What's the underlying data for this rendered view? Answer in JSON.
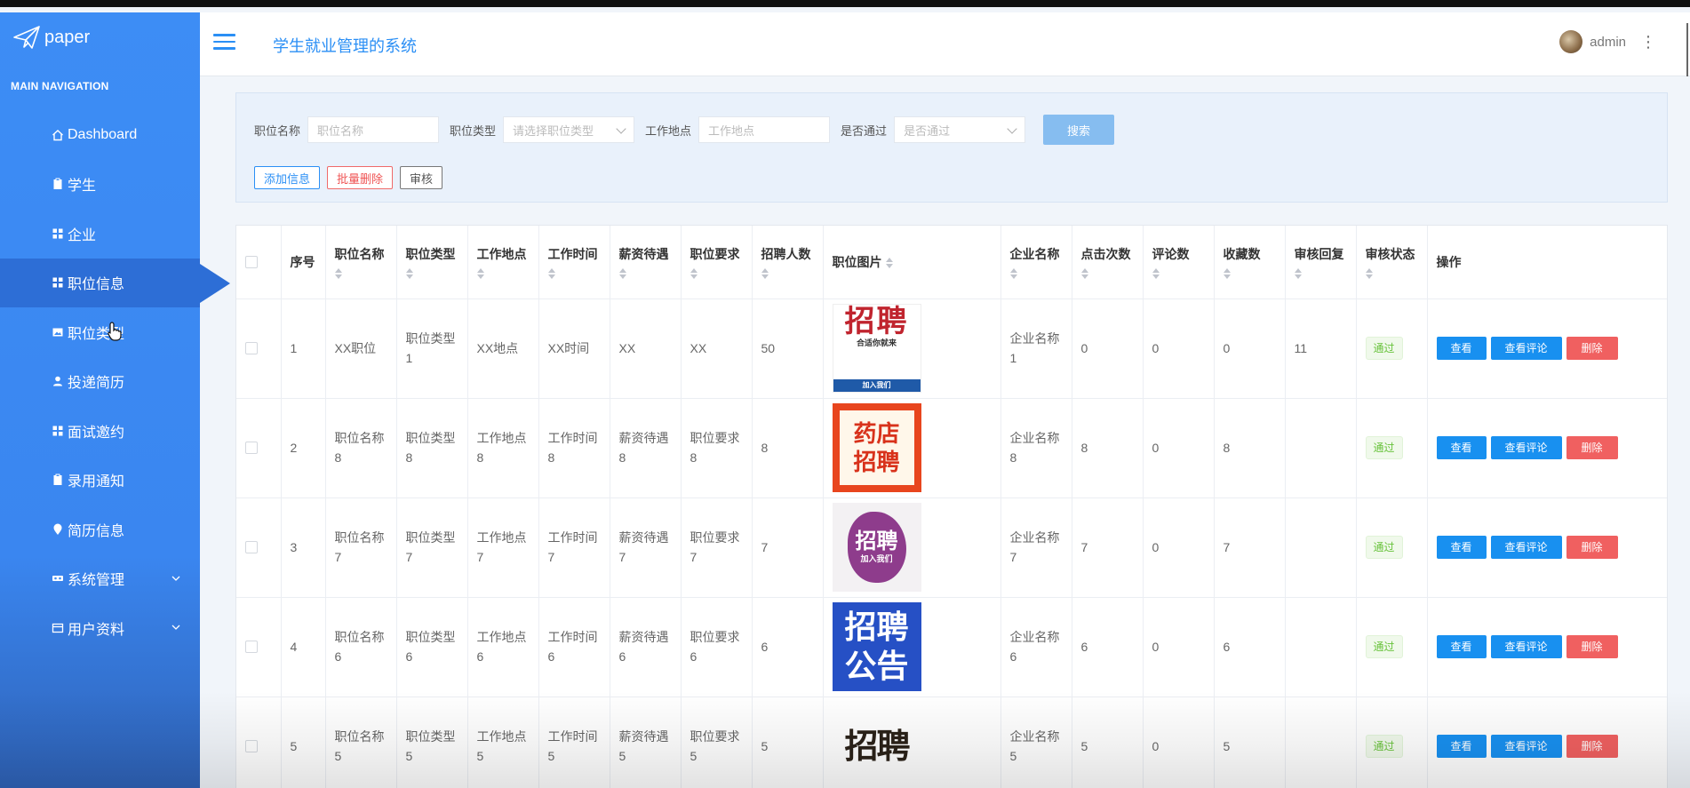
{
  "app": {
    "logo_text": "paper",
    "title": "学生就业管理的系统",
    "user_name": "admin"
  },
  "sidebar": {
    "heading": "MAIN NAVIGATION",
    "items": [
      {
        "label": "Dashboard",
        "icon": "home-icon"
      },
      {
        "label": "学生",
        "icon": "clipboard-icon"
      },
      {
        "label": "企业",
        "icon": "grid-icon"
      },
      {
        "label": "职位信息",
        "icon": "grid-icon",
        "active": true
      },
      {
        "label": "职位类型",
        "icon": "image-icon"
      },
      {
        "label": "投递简历",
        "icon": "user-icon"
      },
      {
        "label": "面试邀约",
        "icon": "grid-icon"
      },
      {
        "label": "录用通知",
        "icon": "clipboard-icon"
      },
      {
        "label": "简历信息",
        "icon": "pin-icon"
      },
      {
        "label": "系统管理",
        "icon": "cog-icon",
        "expandable": true
      },
      {
        "label": "用户资料",
        "icon": "card-icon",
        "expandable": true
      }
    ]
  },
  "filter": {
    "job_name_label": "职位名称",
    "job_name_placeholder": "职位名称",
    "job_type_label": "职位类型",
    "job_type_placeholder": "请选择职位类型",
    "location_label": "工作地点",
    "location_placeholder": "工作地点",
    "approved_label": "是否通过",
    "approved_placeholder": "是否通过",
    "search_label": "搜索",
    "add_label": "添加信息",
    "batch_delete_label": "批量删除",
    "review_label": "审核"
  },
  "table": {
    "headers": {
      "seq": "序号",
      "job_name": "职位名称",
      "job_type": "职位类型",
      "location": "工作地点",
      "work_time": "工作时间",
      "salary": "薪资待遇",
      "requirement": "职位要求",
      "headcount": "招聘人数",
      "picture": "职位图片",
      "company": "企业名称",
      "clicks": "点击次数",
      "comments": "评论数",
      "favorites": "收藏数",
      "review_reply": "审核回复",
      "review_status": "审核状态",
      "actions": "操作"
    },
    "rows": [
      {
        "seq": "1",
        "job_name": "XX职位",
        "job_type": "职位类型1",
        "location": "XX地点",
        "work_time": "XX时间",
        "salary": "XX",
        "requirement": "XX",
        "headcount": "50",
        "pic_text": "招聘",
        "pic_sub": "合适你就来",
        "pic_bar": "加入我们",
        "company": "企业名称1",
        "clicks": "0",
        "comments": "0",
        "favorites": "0",
        "review_reply": "11",
        "status": "通过"
      },
      {
        "seq": "2",
        "job_name": "职位名称8",
        "job_type": "职位类型8",
        "location": "工作地点8",
        "work_time": "工作时间8",
        "salary": "薪资待遇8",
        "requirement": "职位要求8",
        "headcount": "8",
        "pic_text_1": "药店",
        "pic_text_2": "招聘",
        "company": "企业名称8",
        "clicks": "8",
        "comments": "0",
        "favorites": "8",
        "review_reply": "",
        "status": "通过"
      },
      {
        "seq": "3",
        "job_name": "职位名称7",
        "job_type": "职位类型7",
        "location": "工作地点7",
        "work_time": "工作时间7",
        "salary": "薪资待遇7",
        "requirement": "职位要求7",
        "headcount": "7",
        "pic_text": "招聘",
        "pic_sub": "加入我们",
        "company": "企业名称7",
        "clicks": "7",
        "comments": "0",
        "favorites": "7",
        "review_reply": "",
        "status": "通过"
      },
      {
        "seq": "4",
        "job_name": "职位名称6",
        "job_type": "职位类型6",
        "location": "工作地点6",
        "work_time": "工作时间6",
        "salary": "薪资待遇6",
        "requirement": "职位要求6",
        "headcount": "6",
        "pic_text_1": "招聘",
        "pic_text_2": "公告",
        "company": "企业名称6",
        "clicks": "6",
        "comments": "0",
        "favorites": "6",
        "review_reply": "",
        "status": "通过"
      },
      {
        "seq": "5",
        "job_name": "职位名称5",
        "job_type": "职位类型5",
        "location": "工作地点5",
        "work_time": "工作时间5",
        "salary": "薪资待遇5",
        "requirement": "职位要求5",
        "headcount": "5",
        "pic_text": "招聘",
        "company": "企业名称5",
        "clicks": "5",
        "comments": "0",
        "favorites": "5",
        "review_reply": "",
        "status": "通过"
      }
    ],
    "actions": {
      "view": "查看",
      "view_comments": "查看评论",
      "delete": "删除"
    }
  },
  "colors": {
    "sidebar": "#3d8df5",
    "accent": "#2b8ff5",
    "delete": "#f06060",
    "status_ok": "#67c23a"
  }
}
